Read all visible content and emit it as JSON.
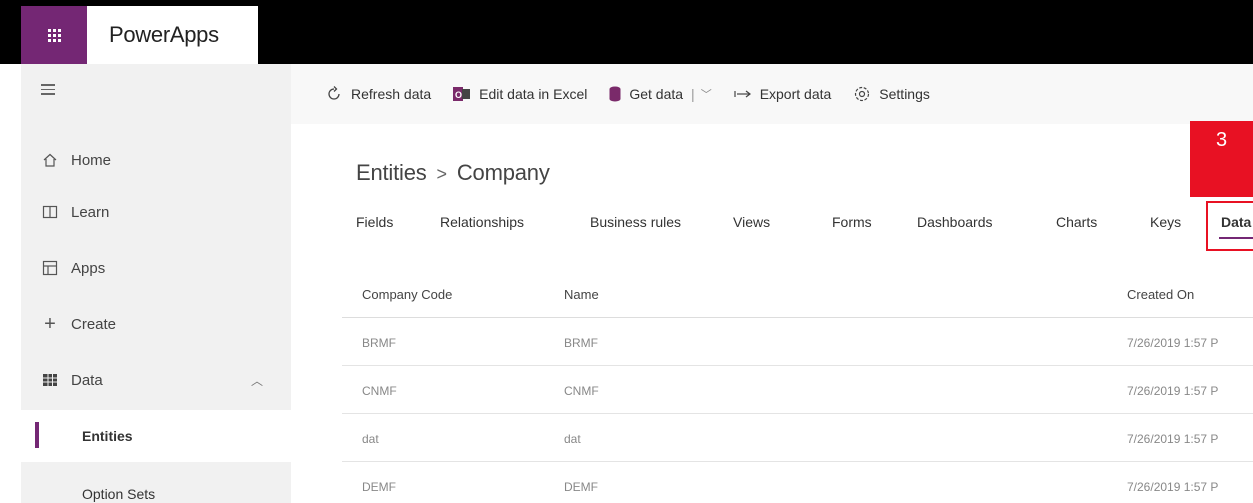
{
  "app": {
    "name": "PowerApps"
  },
  "sidebar": {
    "items": [
      {
        "label": "Home",
        "icon": "home-icon"
      },
      {
        "label": "Learn",
        "icon": "book-icon"
      },
      {
        "label": "Apps",
        "icon": "apps-icon"
      },
      {
        "label": "Create",
        "icon": "plus-icon"
      },
      {
        "label": "Data",
        "icon": "table-icon",
        "expanded": true
      }
    ],
    "subitems": [
      {
        "label": "Entities",
        "active": true
      },
      {
        "label": "Option Sets"
      }
    ]
  },
  "toolbar": {
    "refresh": "Refresh data",
    "edit_excel": "Edit data in Excel",
    "get_data": "Get data",
    "export": "Export data",
    "settings": "Settings"
  },
  "breadcrumb": {
    "parent": "Entities",
    "current": "Company"
  },
  "tabs": [
    "Fields",
    "Relationships",
    "Business rules",
    "Views",
    "Forms",
    "Dashboards",
    "Charts",
    "Keys",
    "Data"
  ],
  "active_tab": "Data",
  "callout": {
    "label": "3"
  },
  "table": {
    "columns": [
      "Company Code",
      "Name",
      "Created On"
    ],
    "rows": [
      [
        "BRMF",
        "BRMF",
        "7/26/2019 1:57 P"
      ],
      [
        "CNMF",
        "CNMF",
        "7/26/2019 1:57 P"
      ],
      [
        "dat",
        "dat",
        "7/26/2019 1:57 P"
      ],
      [
        "DEMF",
        "DEMF",
        "7/26/2019 1:57 P"
      ]
    ]
  },
  "colors": {
    "brand": "#742774",
    "callout": "#e81123",
    "topbar": "#000000"
  }
}
